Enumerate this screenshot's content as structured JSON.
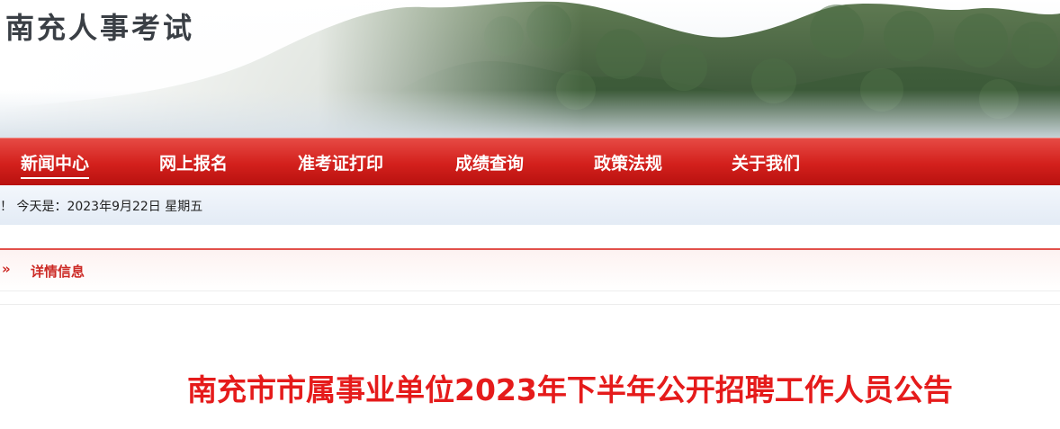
{
  "site": {
    "title": "南充人事考试"
  },
  "nav": {
    "items": [
      {
        "label": "新闻中心"
      },
      {
        "label": "网上报名"
      },
      {
        "label": "准考证打印"
      },
      {
        "label": "成绩查询"
      },
      {
        "label": "政策法规"
      },
      {
        "label": "关于我们"
      }
    ],
    "active": "新闻中心"
  },
  "date_bar": {
    "text": "！ 今天是：2023年9月22日 星期五"
  },
  "detail_bar": {
    "arrows": "»",
    "label": "详情信息"
  },
  "article": {
    "title": "南充市市属事业单位2023年下半年公开招聘工作人员公告"
  },
  "colors": {
    "nav_red": "#d3201c",
    "accent_red": "#cc2a25",
    "title_red": "#e51b1b"
  }
}
